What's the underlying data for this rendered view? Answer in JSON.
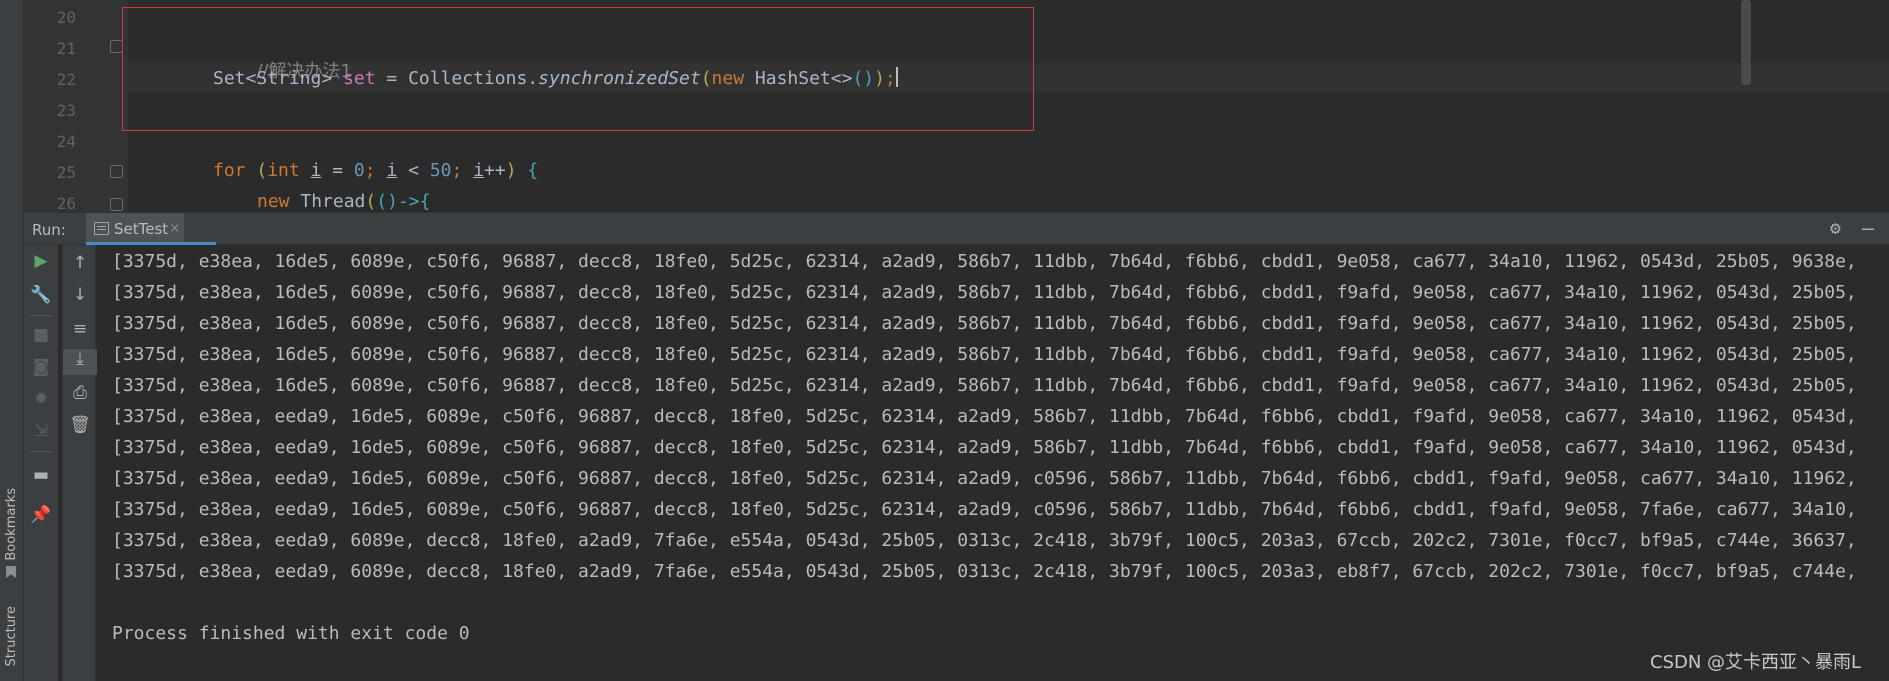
{
  "editor": {
    "lines": [
      {
        "no": "20"
      },
      {
        "no": "21"
      },
      {
        "no": "22"
      },
      {
        "no": "23"
      },
      {
        "no": "24"
      },
      {
        "no": "25"
      },
      {
        "no": "26"
      }
    ],
    "comment": "//解决办法1",
    "set_decl": {
      "type": "Set<String> ",
      "var": "set",
      "assign": " = Collections.",
      "method": "synchronizedSet",
      "open": "(",
      "new_kw": "new ",
      "ctor": "HashSet<>",
      "args": "()",
      "close": ")",
      "semi": ";"
    },
    "for_line": {
      "kw": "for ",
      "open": "(",
      "int_kw": "int ",
      "var1": "i",
      "eq": " = ",
      "zero": "0",
      "semi1": "; ",
      "var2": "i",
      "lt": " < ",
      "fifty": "50",
      "semi2": "; ",
      "var3": "i",
      "inc": "++",
      "close": ")",
      "brace": " {"
    },
    "thread_line": {
      "new_kw": "new ",
      "cls": "Thread",
      "open": "(",
      "lambda": "()->",
      "brace": "{"
    }
  },
  "run_panel": {
    "label": "Run:",
    "tab_name": "SetTest",
    "tab_close": "×",
    "gear": "⚙",
    "minimize": "—"
  },
  "left_strip": {
    "bookmarks": "Bookmarks",
    "structure": "Structure"
  },
  "console": {
    "output": [
      "[3375d, e38ea, 16de5, 6089e, c50f6, 96887, decc8, 18fe0, 5d25c, 62314, a2ad9, 586b7, 11dbb, 7b64d, f6bb6, cbdd1, 9e058, ca677, 34a10, 11962, 0543d, 25b05, 9638e,",
      "[3375d, e38ea, 16de5, 6089e, c50f6, 96887, decc8, 18fe0, 5d25c, 62314, a2ad9, 586b7, 11dbb, 7b64d, f6bb6, cbdd1, f9afd, 9e058, ca677, 34a10, 11962, 0543d, 25b05,",
      "[3375d, e38ea, 16de5, 6089e, c50f6, 96887, decc8, 18fe0, 5d25c, 62314, a2ad9, 586b7, 11dbb, 7b64d, f6bb6, cbdd1, f9afd, 9e058, ca677, 34a10, 11962, 0543d, 25b05,",
      "[3375d, e38ea, 16de5, 6089e, c50f6, 96887, decc8, 18fe0, 5d25c, 62314, a2ad9, 586b7, 11dbb, 7b64d, f6bb6, cbdd1, f9afd, 9e058, ca677, 34a10, 11962, 0543d, 25b05,",
      "[3375d, e38ea, 16de5, 6089e, c50f6, 96887, decc8, 18fe0, 5d25c, 62314, a2ad9, 586b7, 11dbb, 7b64d, f6bb6, cbdd1, f9afd, 9e058, ca677, 34a10, 11962, 0543d, 25b05,",
      "[3375d, e38ea, eeda9, 16de5, 6089e, c50f6, 96887, decc8, 18fe0, 5d25c, 62314, a2ad9, 586b7, 11dbb, 7b64d, f6bb6, cbdd1, f9afd, 9e058, ca677, 34a10, 11962, 0543d,",
      "[3375d, e38ea, eeda9, 16de5, 6089e, c50f6, 96887, decc8, 18fe0, 5d25c, 62314, a2ad9, 586b7, 11dbb, 7b64d, f6bb6, cbdd1, f9afd, 9e058, ca677, 34a10, 11962, 0543d,",
      "[3375d, e38ea, eeda9, 16de5, 6089e, c50f6, 96887, decc8, 18fe0, 5d25c, 62314, a2ad9, c0596, 586b7, 11dbb, 7b64d, f6bb6, cbdd1, f9afd, 9e058, ca677, 34a10, 11962,",
      "[3375d, e38ea, eeda9, 16de5, 6089e, c50f6, 96887, decc8, 18fe0, 5d25c, 62314, a2ad9, c0596, 586b7, 11dbb, 7b64d, f6bb6, cbdd1, f9afd, 9e058, 7fa6e, ca677, 34a10,",
      "[3375d, e38ea, eeda9, 6089e, decc8, 18fe0, a2ad9, 7fa6e, e554a, 0543d, 25b05, 0313c, 2c418, 3b79f, 100c5, 203a3, 67ccb, 202c2, 7301e, f0cc7, bf9a5, c744e, 36637,",
      "[3375d, e38ea, eeda9, 6089e, decc8, 18fe0, a2ad9, 7fa6e, e554a, 0543d, 25b05, 0313c, 2c418, 3b79f, 100c5, 203a3, eb8f7, 67ccb, 202c2, 7301e, f0cc7, bf9a5, c744e,"
    ],
    "finished": "Process finished with exit code 0"
  },
  "watermark": "CSDN @艾卡西亚丶暴雨L",
  "colors": {
    "editor_bg": "#2b2b2b",
    "panel_bg": "#3c3f41",
    "highlight_box": "#d33a3a",
    "keyword": "#cc7832",
    "variable": "#c77dbb",
    "number": "#6897bb",
    "run_green": "#59a869"
  }
}
